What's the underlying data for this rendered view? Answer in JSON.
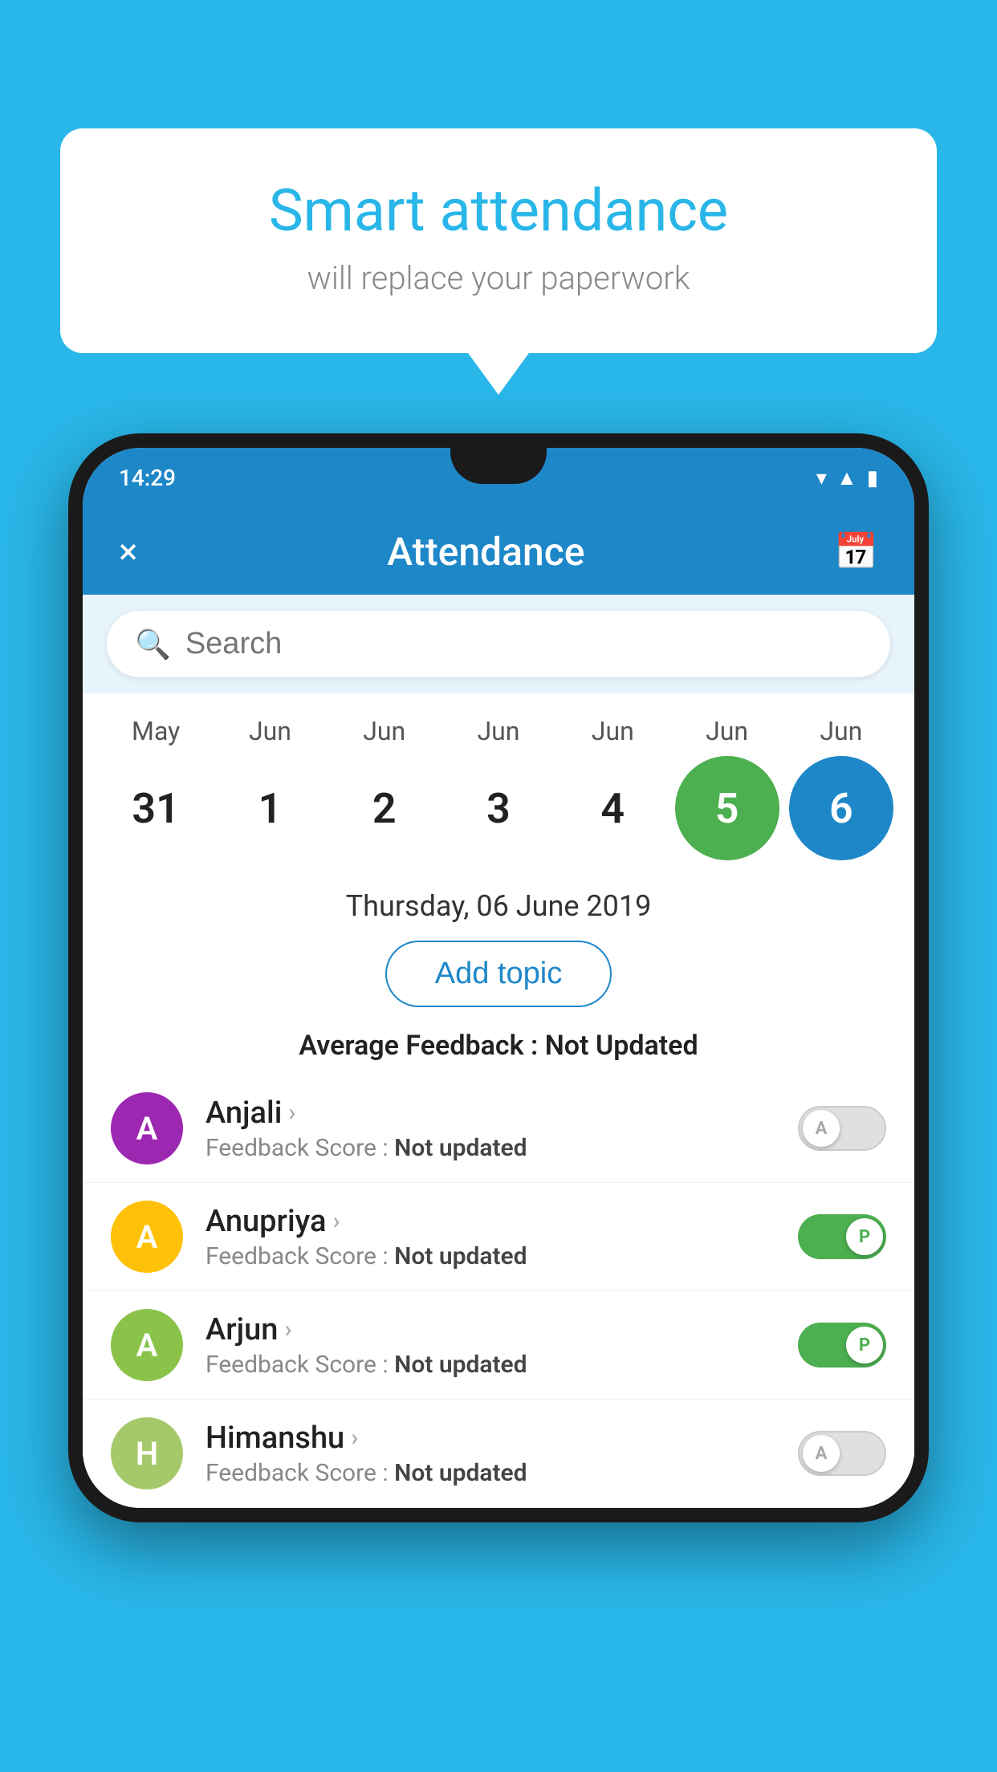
{
  "background_color": "#29b6e8",
  "bubble": {
    "title": "Smart attendance",
    "subtitle": "will replace your paperwork"
  },
  "status_bar": {
    "time": "14:29",
    "icons": [
      "wifi",
      "signal",
      "battery"
    ]
  },
  "app_bar": {
    "title": "Attendance",
    "close_label": "×",
    "calendar_icon": "📅"
  },
  "search": {
    "placeholder": "Search"
  },
  "calendar": {
    "months": [
      "May",
      "Jun",
      "Jun",
      "Jun",
      "Jun",
      "Jun",
      "Jun"
    ],
    "dates": [
      "31",
      "1",
      "2",
      "3",
      "4",
      "5",
      "6"
    ],
    "states": [
      "normal",
      "normal",
      "normal",
      "normal",
      "normal",
      "today",
      "selected"
    ]
  },
  "selected_date": {
    "label": "Thursday, 06 June 2019"
  },
  "add_topic_button": "Add topic",
  "avg_feedback": {
    "label": "Average Feedback : ",
    "value": "Not Updated"
  },
  "students": [
    {
      "name": "Anjali",
      "avatar_letter": "A",
      "avatar_color": "#9c27b0",
      "feedback": "Not updated",
      "toggle_state": "off",
      "toggle_label": "A"
    },
    {
      "name": "Anupriya",
      "avatar_letter": "A",
      "avatar_color": "#ffc107",
      "feedback": "Not updated",
      "toggle_state": "on",
      "toggle_label": "P"
    },
    {
      "name": "Arjun",
      "avatar_letter": "A",
      "avatar_color": "#8bc34a",
      "feedback": "Not updated",
      "toggle_state": "on",
      "toggle_label": "P"
    },
    {
      "name": "Himanshu",
      "avatar_letter": "H",
      "avatar_color": "#a5c96a",
      "feedback": "Not updated",
      "toggle_state": "off",
      "toggle_label": "A"
    }
  ]
}
